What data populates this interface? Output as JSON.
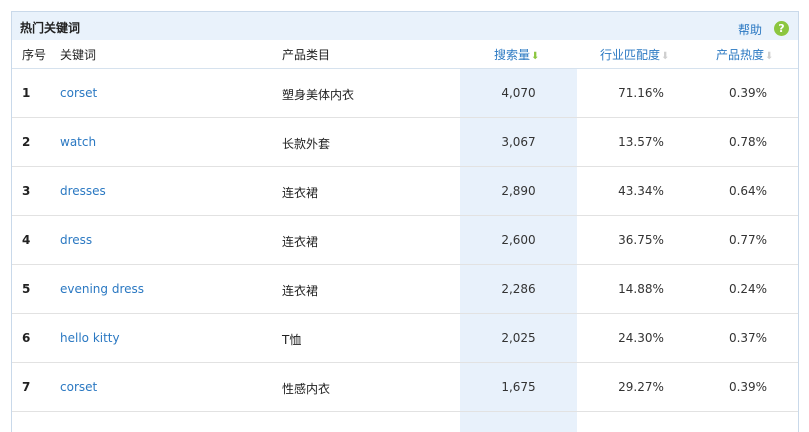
{
  "panel": {
    "title": "热门关键词",
    "help_label": "帮助",
    "help_icon_glyph": "?"
  },
  "columns": {
    "index": "序号",
    "keyword": "关键词",
    "category": "产品类目",
    "search_volume": "搜索量",
    "industry_match": "行业匹配度",
    "product_heat": "产品热度"
  },
  "sort": {
    "active_column": "search_volume",
    "direction": "desc",
    "active_color": "#8cc63f"
  },
  "rows": [
    {
      "index": "1",
      "keyword": "corset",
      "category": "塑身美体内衣",
      "search_volume": "4,070",
      "industry_match": "71.16%",
      "product_heat": "0.39%"
    },
    {
      "index": "2",
      "keyword": "watch",
      "category": "长款外套",
      "search_volume": "3,067",
      "industry_match": "13.57%",
      "product_heat": "0.78%"
    },
    {
      "index": "3",
      "keyword": "dresses",
      "category": "连衣裙",
      "search_volume": "2,890",
      "industry_match": "43.34%",
      "product_heat": "0.64%"
    },
    {
      "index": "4",
      "keyword": "dress",
      "category": "连衣裙",
      "search_volume": "2,600",
      "industry_match": "36.75%",
      "product_heat": "0.77%"
    },
    {
      "index": "5",
      "keyword": "evening dress",
      "category": "连衣裙",
      "search_volume": "2,286",
      "industry_match": "14.88%",
      "product_heat": "0.24%"
    },
    {
      "index": "6",
      "keyword": "hello kitty",
      "category": "T恤",
      "search_volume": "2,025",
      "industry_match": "24.30%",
      "product_heat": "0.37%"
    },
    {
      "index": "7",
      "keyword": "corset",
      "category": "性感内衣",
      "search_volume": "1,675",
      "industry_match": "29.27%",
      "product_heat": "0.39%"
    }
  ]
}
